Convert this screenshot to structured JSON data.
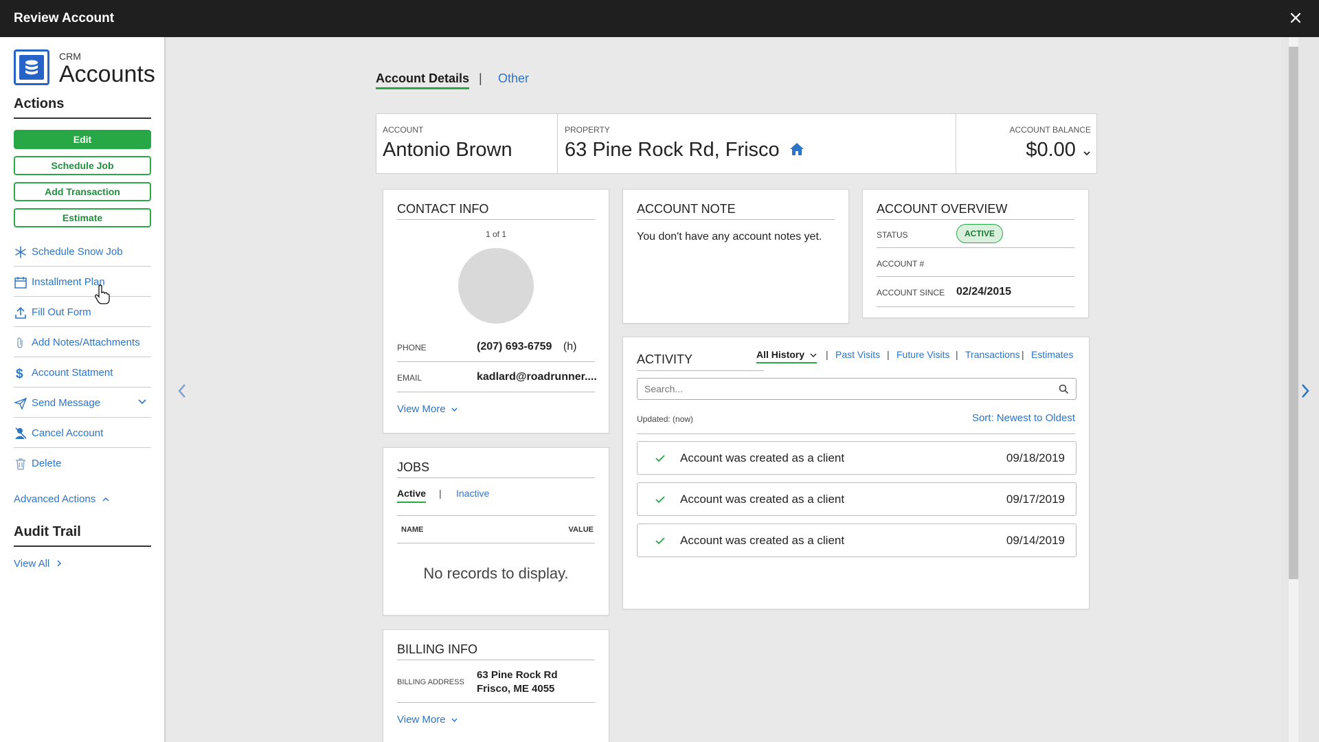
{
  "window": {
    "title": "Review Account"
  },
  "brand": {
    "category": "CRM",
    "name": "Accounts"
  },
  "sidebar": {
    "actions_heading": "Actions",
    "buttons": [
      {
        "label": "Edit"
      },
      {
        "label": "Schedule Job"
      },
      {
        "label": "Add Transaction"
      },
      {
        "label": "Estimate"
      }
    ],
    "items": [
      {
        "label": "Schedule Snow Job",
        "icon": "snowflake-icon"
      },
      {
        "label": "Installment Plan",
        "icon": "calendar-plan-icon"
      },
      {
        "label": "Fill Out Form",
        "icon": "upload-icon"
      },
      {
        "label": "Add Notes/Attachments",
        "icon": "paperclip-icon"
      },
      {
        "label": "Account Statment",
        "icon": "dollar-icon"
      },
      {
        "label": "Send Message",
        "icon": "paper-plane-icon"
      },
      {
        "label": "Cancel Account",
        "icon": "user-remove-icon"
      },
      {
        "label": "Delete",
        "icon": "trash-icon"
      }
    ],
    "advanced_actions": "Advanced Actions",
    "audit_heading": "Audit Trail",
    "view_all": "View All"
  },
  "tabs": {
    "active": "Account Details",
    "separator": "|",
    "other": "Other"
  },
  "header": {
    "account_label": "ACCOUNT",
    "account_value": "Antonio Brown",
    "property_label": "PROPERTY",
    "property_value": "63 Pine Rock Rd, Frisco",
    "balance_label": "ACCOUNT BALANCE",
    "balance_value": "$0.00"
  },
  "contact": {
    "title": "CONTACT INFO",
    "pager": "1 of 1",
    "phone_label": "PHONE",
    "phone_value": "(207) 693-6759",
    "phone_type": "(h)",
    "email_label": "EMAIL",
    "email_value": "kadlard@roadrunner....",
    "view_more": "View More"
  },
  "note": {
    "title": "ACCOUNT NOTE",
    "text": "You don't have any account notes yet."
  },
  "overview": {
    "title": "ACCOUNT OVERVIEW",
    "status_label": "STATUS",
    "status_value": "ACTIVE",
    "account_num_label": "ACCOUNT #",
    "since_label": "ACCOUNT SINCE",
    "since_value": "02/24/2015"
  },
  "activity": {
    "title": "ACTIVITY",
    "filters": [
      "All History",
      "Past Visits",
      "Future Visits",
      "Transactions",
      "Estimates"
    ],
    "separator": "|",
    "search_placeholder": "Search...",
    "updated": "Updated: (now)",
    "sort": "Sort: Newest to Oldest",
    "rows": [
      {
        "text": "Account was created as a client",
        "date": "09/18/2019"
      },
      {
        "text": "Account was created as a client",
        "date": "09/17/2019"
      },
      {
        "text": "Account was created as a client",
        "date": "09/14/2019"
      }
    ]
  },
  "jobs": {
    "title": "JOBS",
    "tab_active": "Active",
    "separator": "|",
    "tab_inactive": "Inactive",
    "col_name": "NAME",
    "col_value": "VALUE",
    "empty": "No records to display."
  },
  "billing": {
    "title": "BILLING INFO",
    "address_label": "BILLING ADDRESS",
    "address_line1": "63 Pine Rock Rd",
    "address_line2": "Frisco, ME 4055",
    "view_more": "View More"
  },
  "colors": {
    "accent_green": "#27a745",
    "link_blue": "#2c74c6",
    "brand_blue": "#2563c9",
    "titlebar": "#1f1f1f"
  }
}
